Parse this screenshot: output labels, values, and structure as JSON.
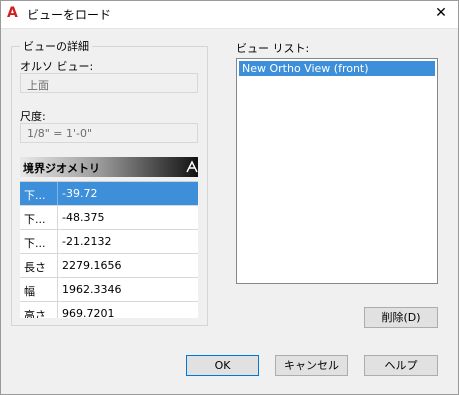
{
  "window": {
    "title": "ビューをロード",
    "close_glyph": "✕",
    "app_icon_letter": "A"
  },
  "details": {
    "group_title": "ビューの詳細",
    "ortho_label": "オルソ ビュー:",
    "ortho_value": "上面",
    "scale_label": "尺度:",
    "scale_value": "1/8\" = 1'-0\"",
    "geometry_header": "境界ジオメトリ",
    "geometry_rows": [
      {
        "name": "下...",
        "value": "-39.72",
        "selected": true
      },
      {
        "name": "下...",
        "value": "-48.375"
      },
      {
        "name": "下...",
        "value": "-21.2132"
      },
      {
        "name": "長さ",
        "value": "2279.1656"
      },
      {
        "name": "幅",
        "value": "1962.3346"
      },
      {
        "name": "高さ",
        "value": "969.7201"
      }
    ]
  },
  "view_list": {
    "label": "ビュー リスト:",
    "items": [
      "New Ortho View (front)"
    ]
  },
  "buttons": {
    "delete": "削除(D)",
    "ok": "OK",
    "cancel": "キャンセル",
    "help": "ヘルプ"
  },
  "colors": {
    "selection": "#3e8fd9",
    "default_button_border": "#0078d7"
  }
}
